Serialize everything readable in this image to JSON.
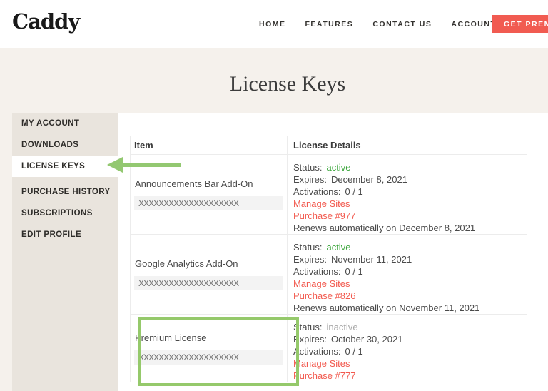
{
  "brand": {
    "name": "Caddy"
  },
  "nav": {
    "links": [
      {
        "label": "HOME"
      },
      {
        "label": "FEATURES"
      },
      {
        "label": "CONTACT US"
      },
      {
        "label": "ACCOUNT"
      }
    ],
    "cta": "GET PREMIUM"
  },
  "page": {
    "title": "License Keys"
  },
  "sidebar": {
    "items": [
      {
        "label": "MY ACCOUNT",
        "active": false
      },
      {
        "label": "DOWNLOADS",
        "active": false
      },
      {
        "label": "LICENSE KEYS",
        "active": true
      },
      {
        "label": "PURCHASE HISTORY",
        "active": false
      },
      {
        "label": "SUBSCRIPTIONS",
        "active": false
      },
      {
        "label": "EDIT PROFILE",
        "active": false
      }
    ]
  },
  "table": {
    "headers": {
      "item": "Item",
      "details": "License Details"
    },
    "labels": {
      "status": "Status:",
      "expires": "Expires:",
      "activations": "Activations:"
    },
    "rows": [
      {
        "name": "Announcements Bar Add-On",
        "key": "XXXXXXXXXXXXXXXXXXXX",
        "status": "active",
        "expires": "December 8, 2021",
        "activations": "0  /  1",
        "manage_sites": "Manage Sites",
        "purchase": "Purchase #977",
        "renews": "Renews automatically on December 8, 2021",
        "highlighted": false
      },
      {
        "name": "Google Analytics Add-On",
        "key": "XXXXXXXXXXXXXXXXXXXX",
        "status": "active",
        "expires": "November 11, 2021",
        "activations": "0  /  1",
        "manage_sites": "Manage Sites",
        "purchase": "Purchase #826",
        "renews": "Renews automatically on November 11, 2021",
        "highlighted": false
      },
      {
        "name": "Premium License",
        "key": "XXXXXXXXXXXXXXXXXXXX",
        "status": "inactive",
        "expires": "October 30, 2021",
        "activations": "0  /  1",
        "manage_sites": "Manage Sites",
        "purchase": "Purchase #777",
        "highlighted": true
      }
    ]
  },
  "colors": {
    "accent_red": "#f15b51",
    "active_green": "#3aa53a",
    "inactive_gray": "#a8a8a8",
    "annotation_green": "#93c871",
    "page_beige": "#f5f1ec",
    "sidebar_beige": "#e9e4dd"
  }
}
